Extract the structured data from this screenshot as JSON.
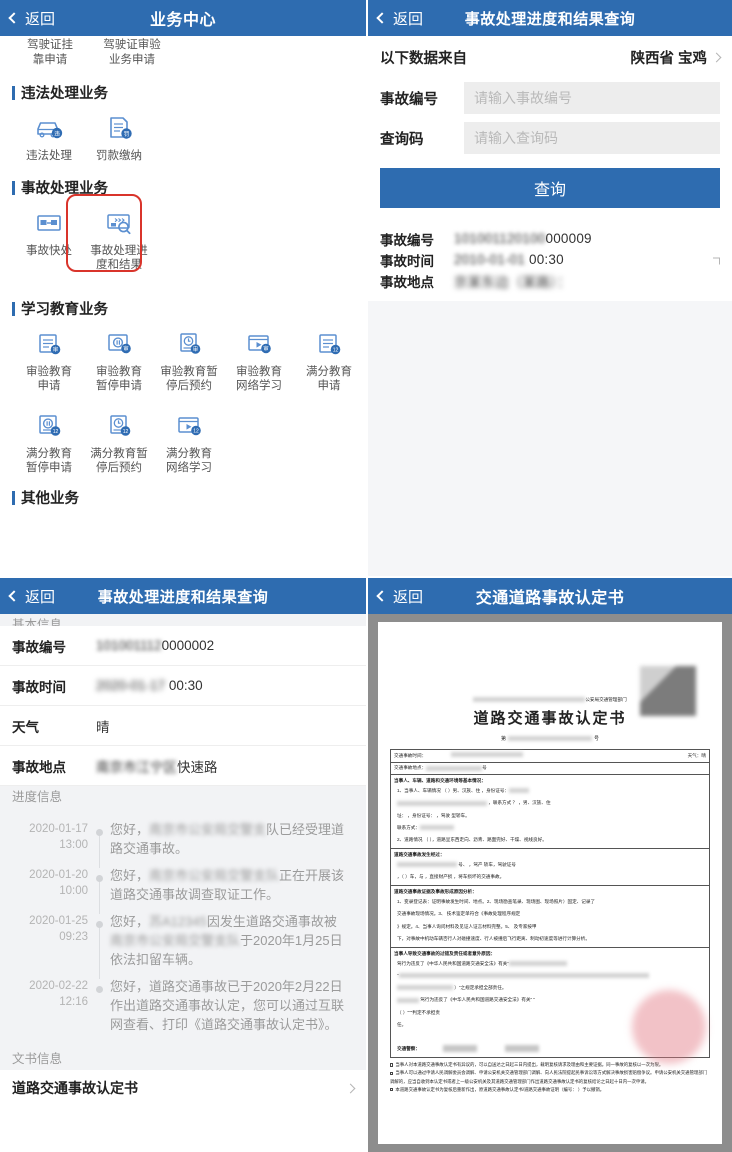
{
  "panel1": {
    "nav": {
      "back": "返回",
      "title": "业务中心"
    },
    "cut_items": [
      "驾驶证挂\n靠申请",
      "驾驶证审验\n业务申请"
    ],
    "sections": [
      {
        "title": "违法处理业务",
        "items": [
          {
            "label": "违法处理",
            "icon": "car-violation-icon"
          },
          {
            "label": "罚款缴纳",
            "icon": "fine-payment-icon"
          }
        ]
      },
      {
        "title": "事故处理业务",
        "items": [
          {
            "label": "事故快处",
            "icon": "accident-quick-handle-icon"
          },
          {
            "label": "事故处理进\n度和结果",
            "icon": "accident-progress-search-icon",
            "highlighted": true
          }
        ]
      },
      {
        "title": "学习教育业务",
        "items": [
          {
            "label": "审验教育\n申请",
            "icon": "doc-badge-icon"
          },
          {
            "label": "审验教育\n暂停申请",
            "icon": "pause-badge-icon"
          },
          {
            "label": "审验教育暂\n停后预约",
            "icon": "clock-badge-icon"
          },
          {
            "label": "审验教育\n网络学习",
            "icon": "play-badge-icon"
          },
          {
            "label": "满分教育\n申请",
            "icon": "doc12-badge-icon"
          },
          {
            "label": "满分教育\n暂停申请",
            "icon": "pause12-badge-icon"
          },
          {
            "label": "满分教育暂\n停后预约",
            "icon": "clock12-badge-icon"
          },
          {
            "label": "满分教育\n网络学习",
            "icon": "play12-badge-icon"
          }
        ]
      }
    ],
    "last_section_title": "其他业务",
    "accent": "#2e6cb0",
    "highlight_color": "#d9342b"
  },
  "panel2": {
    "nav": {
      "back": "返回",
      "title": "事故处理进度和结果查询"
    },
    "source": {
      "label": "以下数据来自",
      "value": "陕西省 宝鸡"
    },
    "form": {
      "fields": [
        {
          "label": "事故编号",
          "placeholder": "请输入事故编号",
          "value": ""
        },
        {
          "label": "查询码",
          "placeholder": "请输入查询码",
          "value": ""
        }
      ],
      "submit_label": "查询"
    },
    "result": {
      "rows": [
        {
          "label": "事故编号",
          "redacted": "101001120100",
          "plain": "000009"
        },
        {
          "label": "事故时间",
          "redacted": "2010-01-01",
          "plain": "00:30"
        },
        {
          "label": "事故地点",
          "redacted": "京某东边（某路）：",
          "plain": ""
        }
      ]
    }
  },
  "panel3": {
    "nav": {
      "back": "返回",
      "title": "事故处理进度和结果查询"
    },
    "group_basic": "基本信息",
    "basic_rows": [
      {
        "label": "事故编号",
        "redacted": "101001112",
        "plain": "0000002"
      },
      {
        "label": "事故时间",
        "redacted": "2020-01-17",
        "plain": "00:30"
      },
      {
        "label": "天气",
        "redacted": "",
        "plain": "晴"
      },
      {
        "label": "事故地点",
        "redacted": "南京市江宁区",
        "plain": "快速路"
      }
    ],
    "group_progress": "进度信息",
    "timeline": [
      {
        "date": "2020-01-17",
        "time": "13:00",
        "pre": "您好，",
        "redacted": "南京市公安局交警支",
        "post": "队已经受理道路交通事故。"
      },
      {
        "date": "2020-01-20",
        "time": "10:00",
        "pre": "您好，",
        "redacted": "南京市公安局交警支队",
        "post": "正在开展该道路交通事故调查取证工作。"
      },
      {
        "date": "2020-01-25",
        "time": "09:23",
        "pre": "您好，",
        "redacted": "苏A12345",
        "post": "因发生道路交通事故被",
        "redacted2": "南京市公安局交警支队",
        "post2": "于2020年1月25日依法扣留车辆。"
      },
      {
        "date": "2020-02-22",
        "time": "12:16",
        "pre": "",
        "redacted": "",
        "post": "您好，道路交通事故已于2020年2月22日作出道路交通事故认定，您可以通过互联网查看、打印《道路交通事故认定书》。"
      }
    ],
    "group_doc": "文书信息",
    "doc_item": "道路交通事故认定书"
  },
  "panel4": {
    "nav": {
      "back": "返回",
      "title": "交通道路事故认定书"
    },
    "doc": {
      "org_line": "公安局交通管理部门",
      "title": "道路交通事故认定书",
      "no_prefix": "第",
      "no_suffix": "号",
      "rows": [
        {
          "label": "交通事故时间：",
          "right_label": "天气：",
          "right_value": "晴"
        },
        {
          "label": "交通事故地点：",
          "suffix": "号"
        }
      ],
      "blocks": [
        {
          "head": "当事人、车辆、道路和交通环境等基本情况：",
          "lines": [
            "1、当事人、车辆情况    （    ）男、汉族、住        ，身份证号：",
            "              ，联系方式       ？      ，男、汉族、住",
            "址：              ，身份证号：     ，驾驶        型轿车。",
            "联系方式：",
            "2、道路情况    （      ），道路呈东西走向、沥青、路面完好、干燥、视线良好。"
          ]
        },
        {
          "head": "道路交通事故发生经过：",
          "lines": [
            "            号、      ，驾产       轿车，驾驶证号",
            "   ，（              ）车，与        ，直接财产损       ，将车损坏的交通事故。"
          ]
        },
        {
          "head": "道路交通事故证据及事故形成原因分析：",
          "lines": [
            "1、变录登记表：证明事故发生时间、地点。2、现场勘查笔录、现场图、现场照片）固定、记录了",
            "交通事故现场情况。3、              技术鉴定单符合《事故处理程序规定",
            "》规定。4、当事人询问材料及见证人证言材料完整。5、              及专家按甲",
            "下，对事故中机动车辆否行人对碰撞速度、行人被撞后飞行距离、制动初速度等进行计算分析。"
          ]
        },
        {
          "head": "当事人导致交通事故的过错及责任或者意外原因：",
          "lines": [
            "      驾行为违反了《中华人民共和国道路交通安全法》有关\"",
            "\"",
            "            ）\"之规定承担全部责任。",
            "      驾行为违反了《中华人民共和国道路交通安全法》有关\"                    \"",
            "      （                                      ）\"\"\"判定不承担责",
            "任。"
          ]
        }
      ],
      "officer_label": "交通警察：",
      "footnotes": [
        "当事人对本道路交通事故认定书有异议的，可以自送达之日起三日内提出，载明复核请求及理由和主要证据。同一事故的复核以一次为限。",
        "当事人可以通过申请人民调解委员会调解、申请公安机关交通管理部门调解、向人民法院提起民事诉讼等方式解决事故损害赔偿争议。申请公安机关交通管理部门调解的，应当自收到本认定书或者上一级公安机关及其道路交通管理部门作出道路交通事故认定书的复核结论之日起十日内一次申请。",
        "本道路交通事故认定书为复核后重新作出，原道路交通事故认定书/道路交通事故证明（编号：                    ）予以撤销。"
      ]
    }
  }
}
